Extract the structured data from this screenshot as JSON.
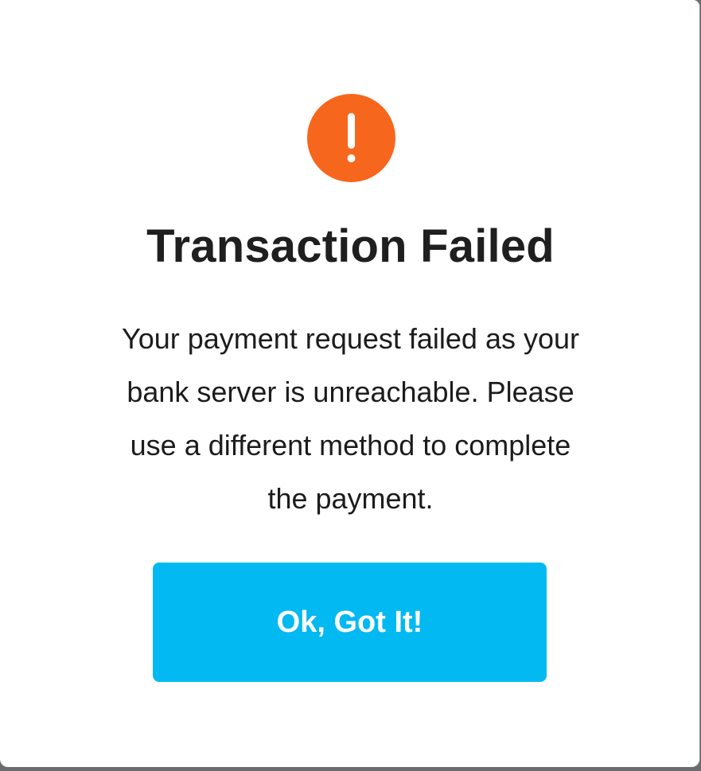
{
  "dialog": {
    "icon": "exclamation-icon",
    "title": "Transaction Failed",
    "message": "Your payment request failed as your\nbank server is unreachable.  Please\nuse a different method to complete\nthe payment.",
    "ok_button_label": "Ok, Got It!"
  },
  "colors": {
    "icon_background": "#f7661d",
    "button_background": "#02b9f2",
    "title_text": "#1f1f1f",
    "button_text": "#ffffff"
  }
}
